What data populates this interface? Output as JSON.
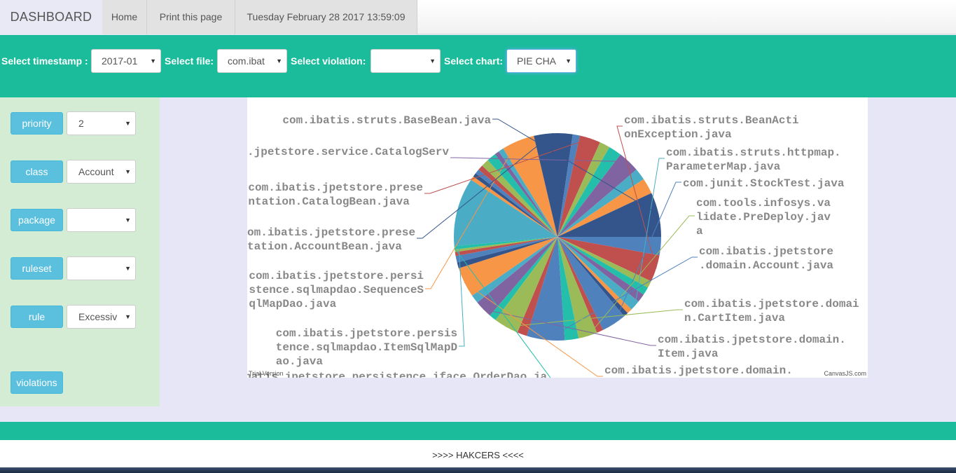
{
  "nav": {
    "brand": "DASHBOARD",
    "home": "Home",
    "print": "Print this page",
    "datetime": "Tuesday February 28 2017 13:59:09"
  },
  "filters": {
    "timestamp_label": "Select timestamp :",
    "timestamp_value": "2017-01",
    "file_label": "Select file:",
    "file_value": "com.ibat",
    "violation_label": "Select violation:",
    "violation_value": "",
    "chart_label": "Select chart:",
    "chart_value": "PIE CHA"
  },
  "side": {
    "priority_label": "priority",
    "priority_value": "2",
    "class_label": "class",
    "class_value": "Account",
    "package_label": "package",
    "package_value": "",
    "ruleset_label": "ruleset",
    "ruleset_value": "",
    "rule_label": "rule",
    "rule_value": "Excessiv",
    "violations_label": "violations"
  },
  "chart_data": {
    "type": "pie",
    "credit_left": "Trial Version",
    "credit_right": "CanvasJS.com",
    "slices": [
      {
        "label": "",
        "value": 2.8,
        "color": "#4F81BC"
      },
      {
        "label": "com.ibatis.struts.BeanActionException.java",
        "value": 4.1,
        "color": "#C0504E"
      },
      {
        "label": "",
        "value": 1.1,
        "color": "#9BBB58"
      },
      {
        "label": "",
        "value": 1.2,
        "color": "#23BFAA"
      },
      {
        "label": "",
        "value": 1.3,
        "color": "#8064A1"
      },
      {
        "label": "com.ibatis.struts.httpmap.ParameterMap.java",
        "value": 1.6,
        "color": "#4AACC5"
      },
      {
        "label": "",
        "value": 0.8,
        "color": "#F79647"
      },
      {
        "label": "",
        "value": 0.7,
        "color": "#33558B"
      },
      {
        "label": "com.junit.StockTest.java",
        "value": 3.8,
        "color": "#4F81BC"
      },
      {
        "label": "",
        "value": 1.0,
        "color": "#C0504E"
      },
      {
        "label": "com.tools.infosys.validate.PreDeploy.java",
        "value": 2.9,
        "color": "#9BBB58"
      },
      {
        "label": "",
        "value": 2.1,
        "color": "#23BFAA"
      },
      {
        "label": "com.ibatis.jpetstore.domain.Account.java",
        "value": 5.8,
        "color": "#4F81BC"
      },
      {
        "label": "",
        "value": 1.5,
        "color": "#C0504E"
      },
      {
        "label": "com.ibatis.jpetstore.domain.CartItem.java",
        "value": 3.8,
        "color": "#9BBB58"
      },
      {
        "label": "",
        "value": 1.1,
        "color": "#23BFAA"
      },
      {
        "label": "com.ibatis.jpetstore.domain.Item.java",
        "value": 2.7,
        "color": "#8064A1"
      },
      {
        "label": "",
        "value": 1.3,
        "color": "#4AACC5"
      },
      {
        "label": "com.ibatis.jpetstore.domain.Order.java",
        "value": 4.6,
        "color": "#F79647"
      },
      {
        "label": "",
        "value": 0.9,
        "color": "#33558B"
      },
      {
        "label": "",
        "value": 1.0,
        "color": "#4F81BC"
      },
      {
        "label": "",
        "value": 0.6,
        "color": "#C0504E"
      },
      {
        "label": "",
        "value": 0.4,
        "color": "#9BBB58"
      },
      {
        "label": "com.ibatis.jpetstore.persistence.iface.OrderDao.java",
        "value": 0.5,
        "color": "#23BFAA"
      },
      {
        "label": "com.ibatis.jpetstore.persistence.sqlmapdao.ItemSqlMapDao.java",
        "value": 10.5,
        "color": "#4AACC5"
      },
      {
        "label": "",
        "value": 0.6,
        "color": "#F79647"
      },
      {
        "label": "",
        "value": 0.6,
        "color": "#33558B"
      },
      {
        "label": "",
        "value": 0.7,
        "color": "#4F81BC"
      },
      {
        "label": "",
        "value": 0.8,
        "color": "#C0504E"
      },
      {
        "label": "",
        "value": 1.2,
        "color": "#9BBB58"
      },
      {
        "label": "",
        "value": 1.4,
        "color": "#23BFAA"
      },
      {
        "label": "",
        "value": 0.7,
        "color": "#8064A1"
      },
      {
        "label": "",
        "value": 0.8,
        "color": "#4AACC5"
      },
      {
        "label": "com.ibatis.jpetstore.persistence.sqlmapdao.SequenceSqlMapDao.java",
        "value": 5.0,
        "color": "#F79647"
      },
      {
        "label": "com.ibatis.jpetstore.presentation.AccountBean.java",
        "value": 5.9,
        "color": "#33558B"
      },
      {
        "label": "",
        "value": 1.1,
        "color": "#4F81BC"
      },
      {
        "label": "com.ibatis.jpetstore.presentation.CatalogBean.java",
        "value": 3.2,
        "color": "#C0504E"
      },
      {
        "label": "",
        "value": 1.6,
        "color": "#9BBB58"
      },
      {
        "label": "",
        "value": 2.0,
        "color": "#23BFAA"
      },
      {
        "label": "com.ibatis.jpetstore.service.CatalogService.java",
        "value": 3.3,
        "color": "#8064A1"
      },
      {
        "label": "",
        "value": 1.8,
        "color": "#4AACC5"
      },
      {
        "label": "",
        "value": 2.4,
        "color": "#F79647"
      },
      {
        "label": "com.ibatis.struts.BaseBean.java",
        "value": 6.8,
        "color": "#33558B"
      }
    ]
  },
  "footer": {
    "text": ">>>> HAKCERS <<<<"
  }
}
